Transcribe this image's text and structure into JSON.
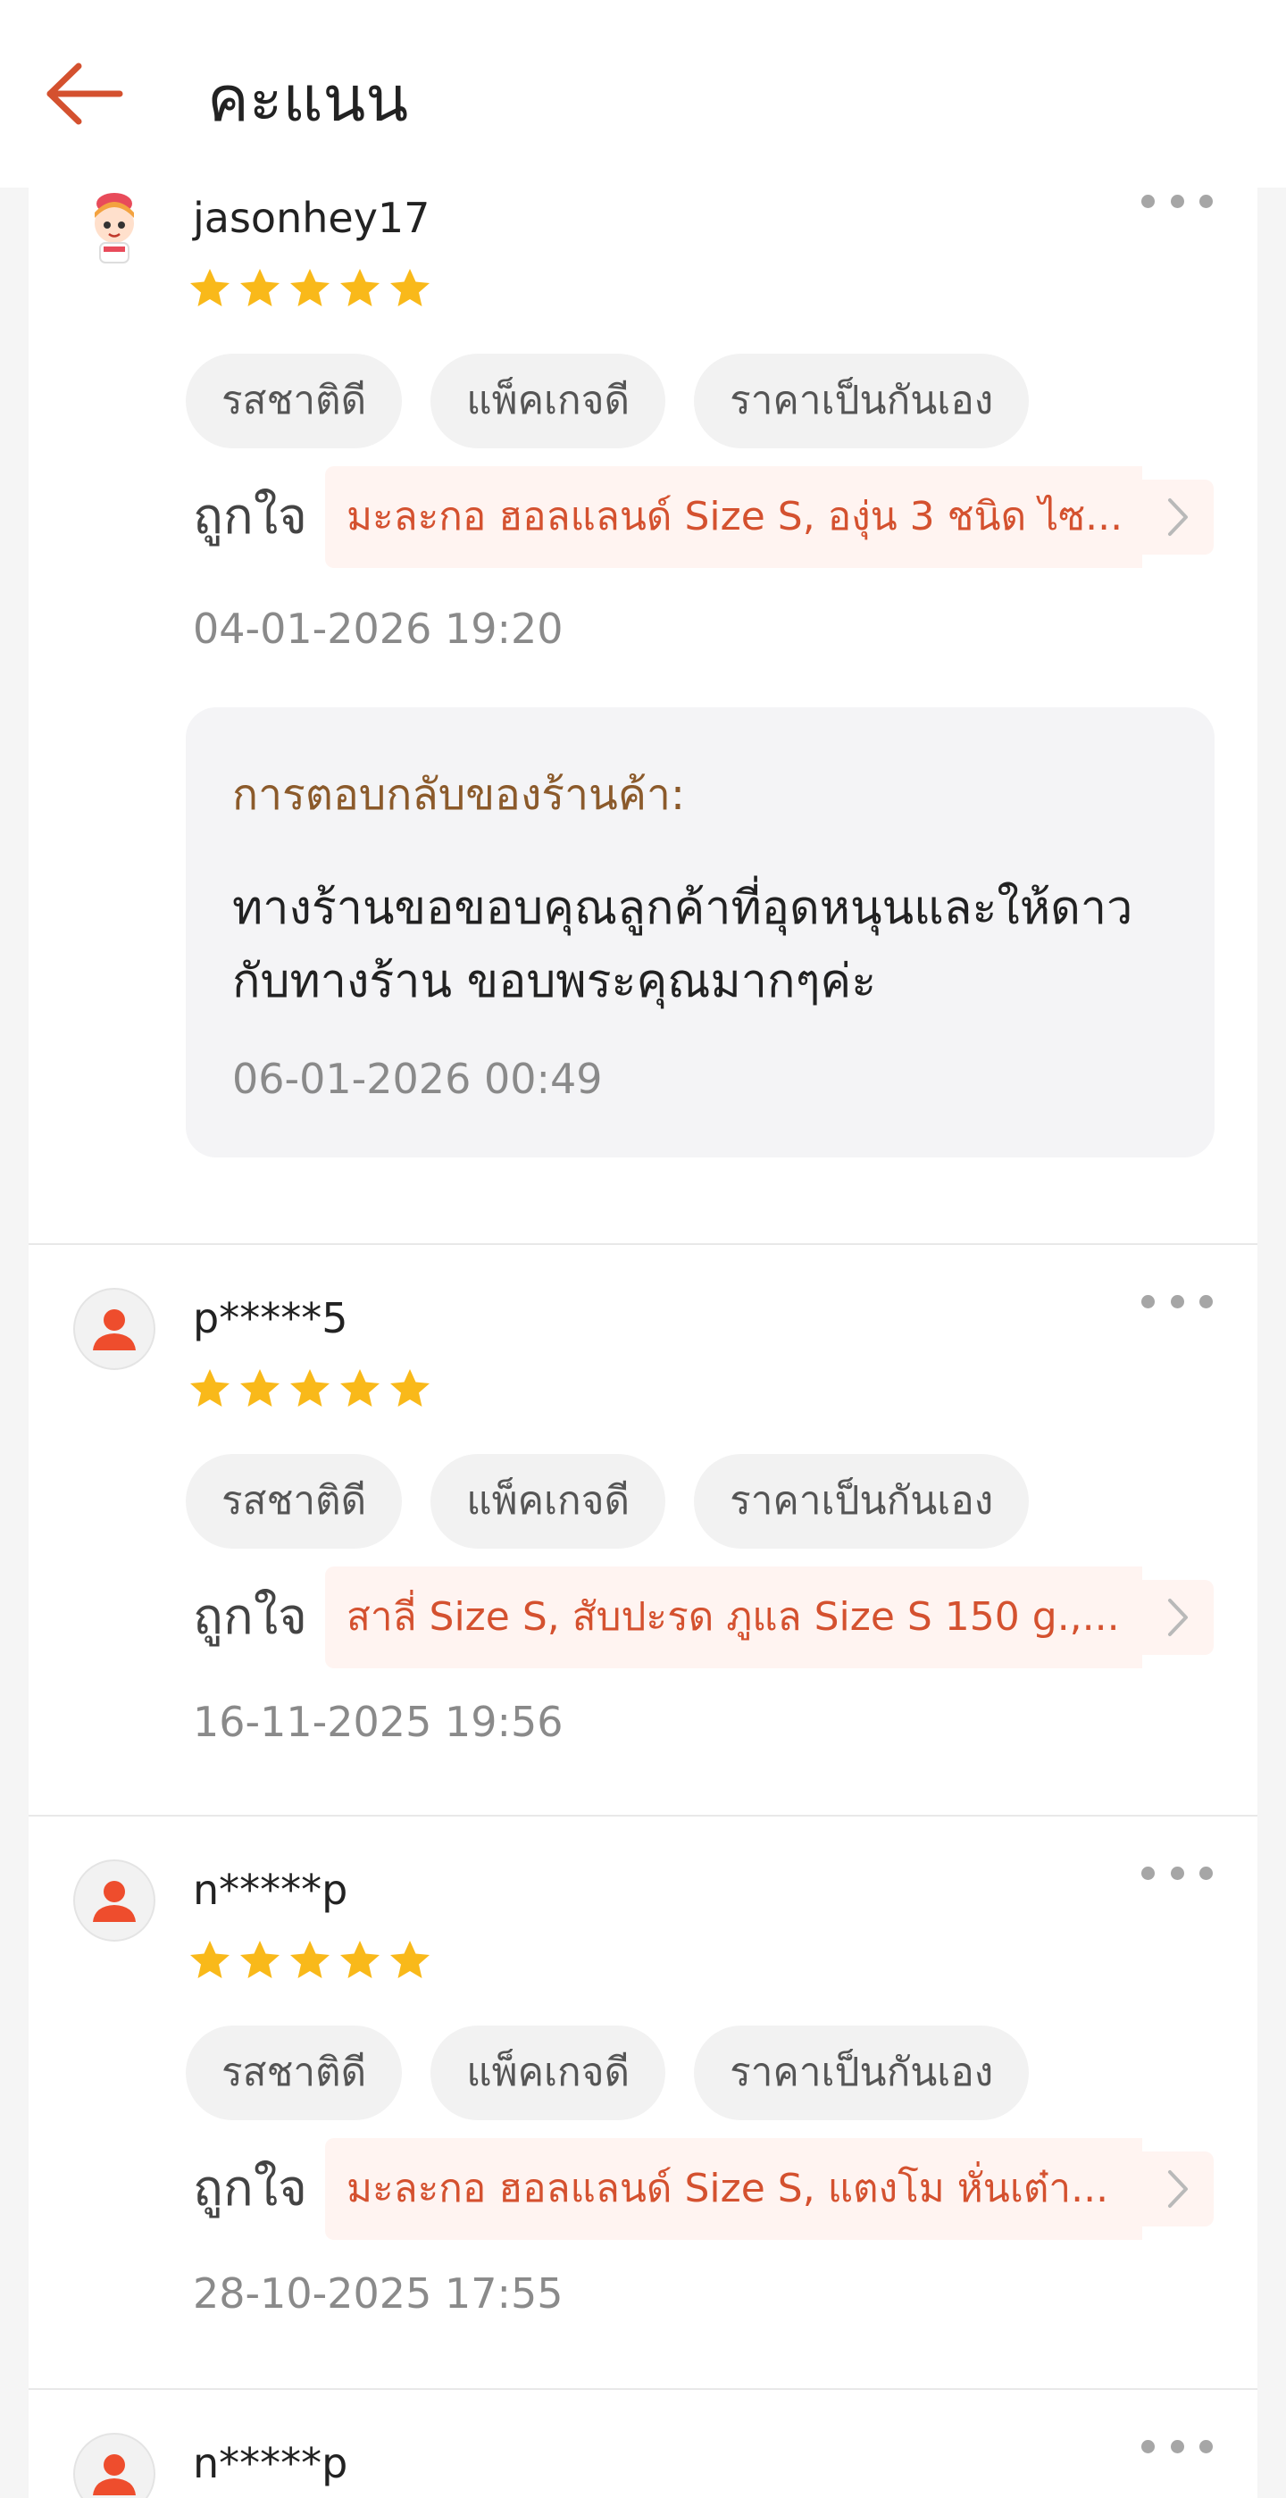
{
  "header": {
    "title": "คะแนน",
    "back_icon": "arrow-left-icon",
    "accent_color": "#d4512f"
  },
  "reviews": [
    {
      "username": "jasonhey17",
      "avatar": "cartoon-avatar",
      "rating": 5,
      "tags": [
        "รสชาติดี",
        "แพ็คเกจดี",
        "ราคาเป็นกันเอง"
      ],
      "liked_label": "ถูกใจ",
      "liked_items": "มะละกอ ฮอลแลนด์ Size S, องุ่น 3 ชนิด ไซ...",
      "date": "04-01-2026 19:20",
      "reply": {
        "title": "การตอบกลับของร้านค้า:",
        "text": "ทางร้านขอขอบคุณลูกค้าที่อุดหนุนและให้ดาวกับทางร้าน ขอบพระคุณมากๆค่ะ",
        "date": "06-01-2026 00:49"
      }
    },
    {
      "username": "p*****5",
      "avatar": "default-user-avatar",
      "rating": 5,
      "tags": [
        "รสชาติดี",
        "แพ็คเกจดี",
        "ราคาเป็นกันเอง"
      ],
      "liked_label": "ถูกใจ",
      "liked_items": "สาลี่ Size S, สับปะรด ภูแล Size S  150 g.,...",
      "date": "16-11-2025 19:56"
    },
    {
      "username": "n*****p",
      "avatar": "default-user-avatar",
      "rating": 5,
      "tags": [
        "รสชาติดี",
        "แพ็คเกจดี",
        "ราคาเป็นกันเอง"
      ],
      "liked_label": "ถูกใจ",
      "liked_items": "มะละกอ ฮอลแลนด์ Size S, แตงโม หั่นเต๋า...",
      "date": "28-10-2025 17:55"
    },
    {
      "username": "n*****p",
      "avatar": "default-user-avatar"
    }
  ]
}
